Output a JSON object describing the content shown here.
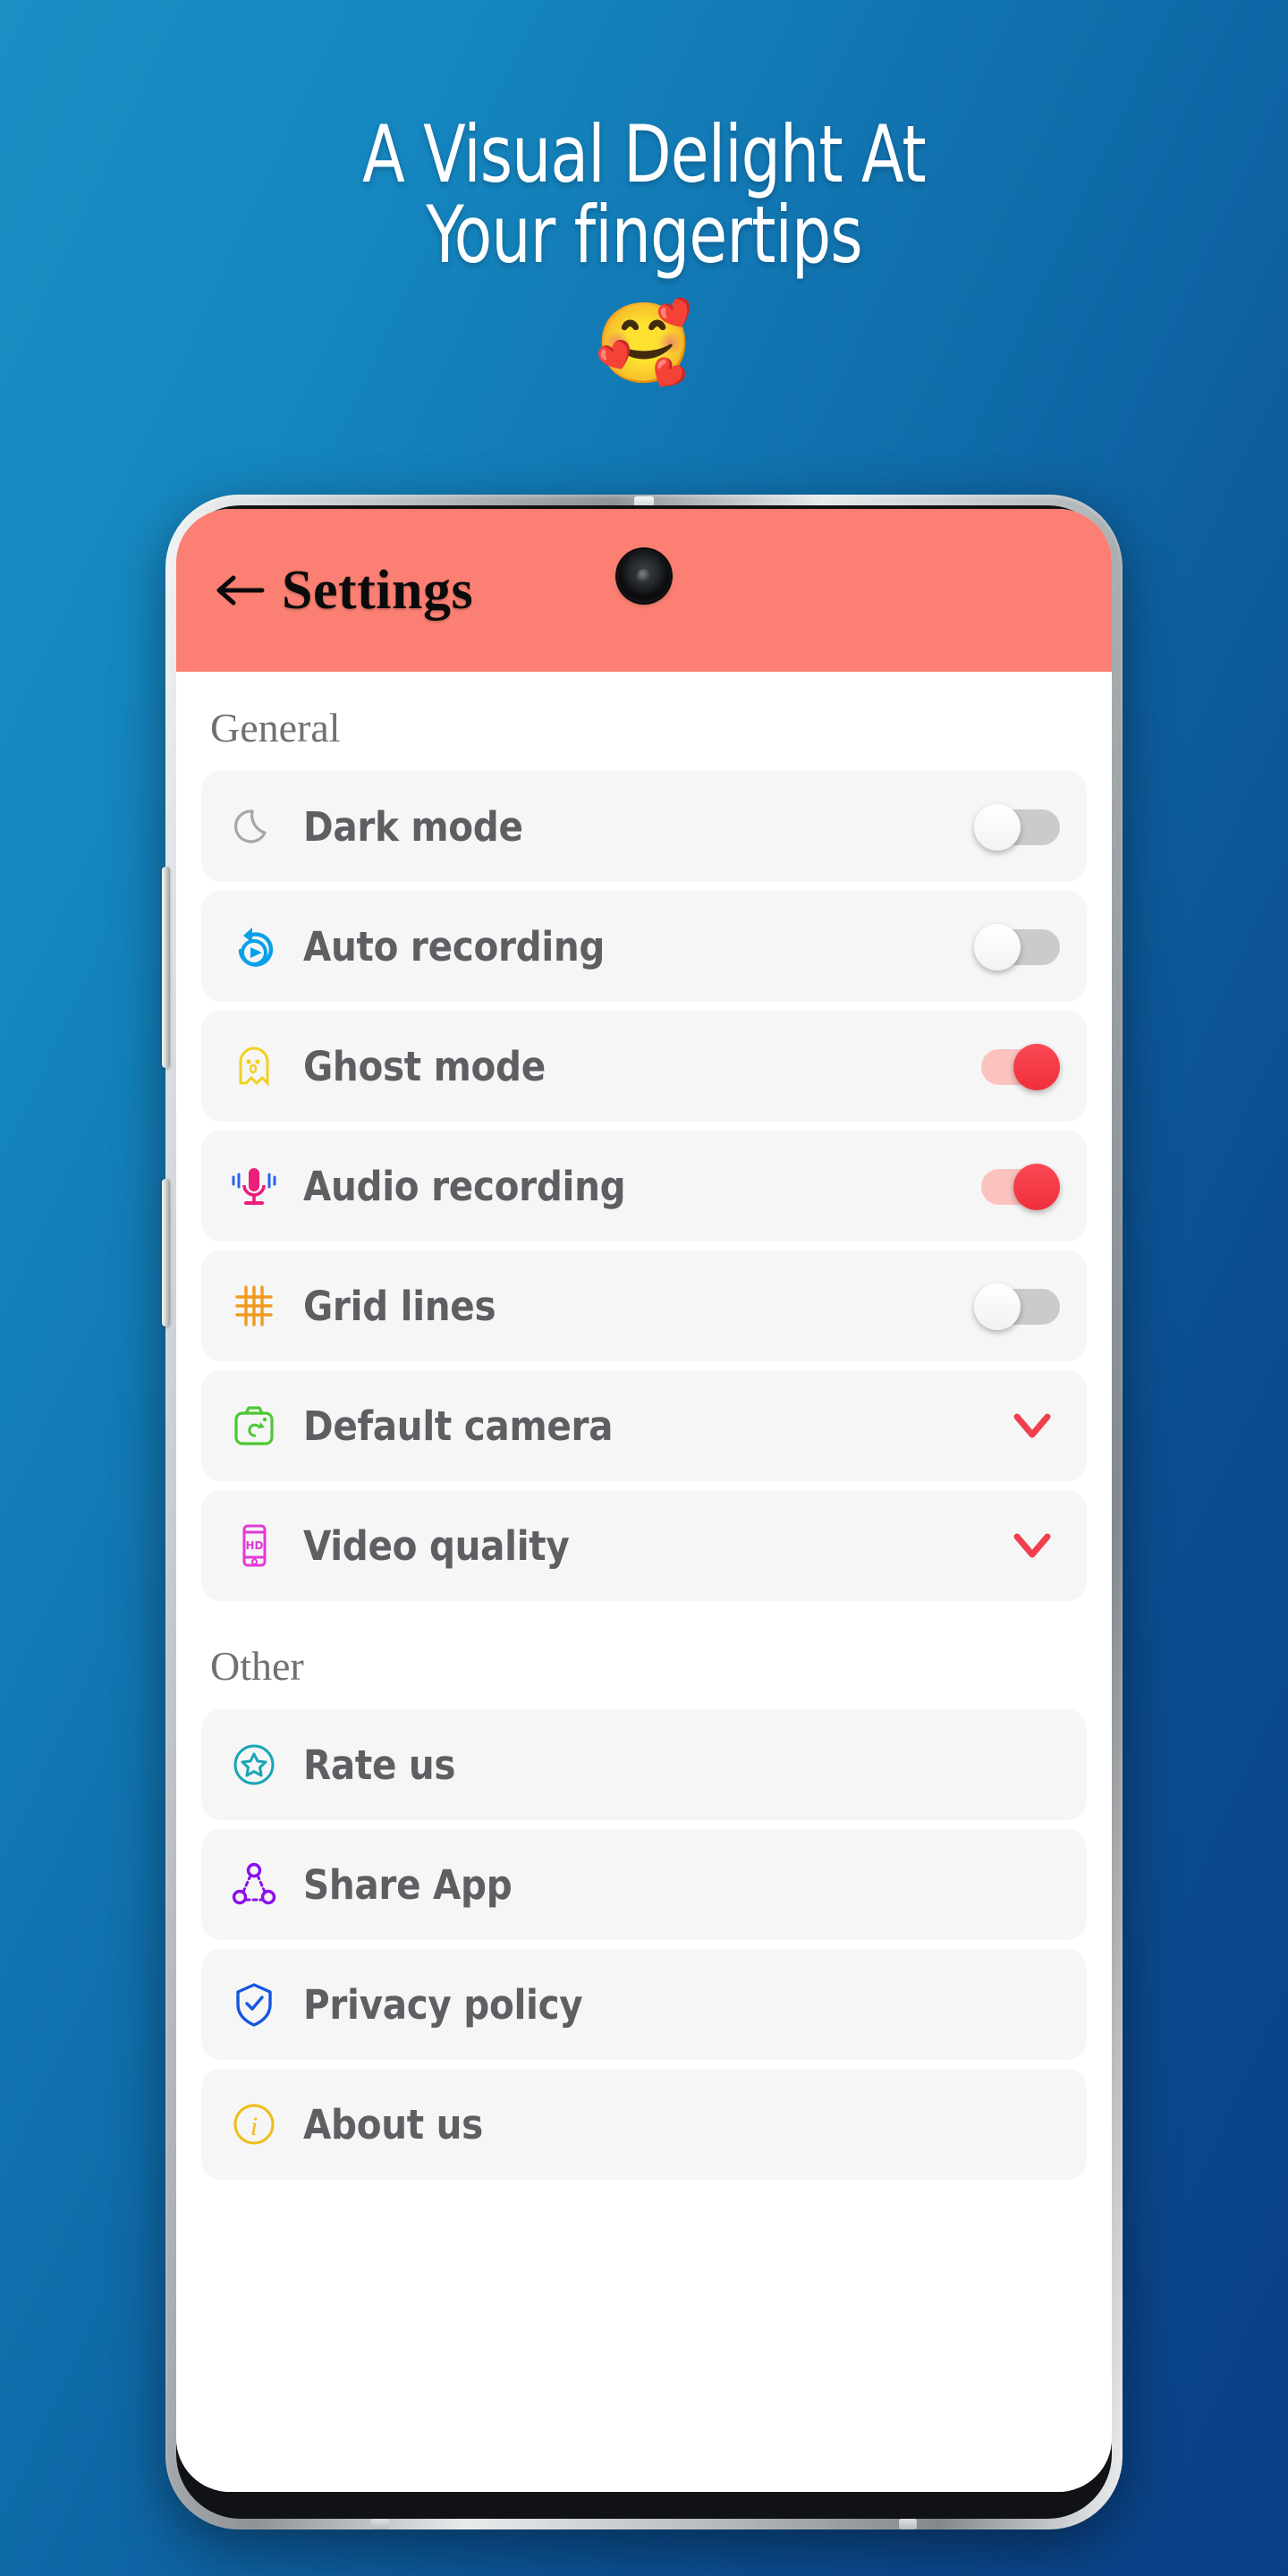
{
  "promo": {
    "line1": "A Visual Delight At",
    "line2": "Your fingertips",
    "emoji": "🥰",
    "emoji_name": "smiling-face-with-hearts"
  },
  "colors": {
    "background_top": "#1b8fc4",
    "background_bottom": "#0a3f85",
    "header": "#fb7f72",
    "toggle_on": "#f02e3c",
    "toggle_on_track": "#fbc3c0",
    "toggle_off_track": "#c9cbcd",
    "chevron": "#f0404d",
    "label_text": "#5d5f62",
    "section_text": "#6f7174",
    "row_background": "#f6f6f6"
  },
  "app": {
    "header": {
      "title": "Settings",
      "back_icon": "arrow-left-icon",
      "camera_icon": "front-camera-punch-hole"
    },
    "sections": [
      {
        "title": "General",
        "rows": [
          {
            "label": "Dark mode",
            "icon": "moon-icon",
            "icon_color": "#9a9c9f",
            "control": "toggle",
            "state": "off"
          },
          {
            "label": "Auto recording",
            "icon": "auto-record-icon",
            "icon_color": "#0aa0e8",
            "control": "toggle",
            "state": "off"
          },
          {
            "label": "Ghost mode",
            "icon": "ghost-icon",
            "icon_color": "#f2d021",
            "control": "toggle",
            "state": "on"
          },
          {
            "label": "Audio recording",
            "icon": "microphone-icon",
            "icon_color": "#ec1f7a",
            "control": "toggle",
            "state": "on"
          },
          {
            "label": "Grid lines",
            "icon": "grid-icon",
            "icon_color": "#f09a21",
            "control": "toggle",
            "state": "off"
          },
          {
            "label": "Default camera",
            "icon": "camera-switch-icon",
            "icon_color": "#4cc831",
            "control": "chevron"
          },
          {
            "label": "Video quality",
            "icon": "hd-phone-icon",
            "icon_color": "#e23ad6",
            "control": "chevron"
          }
        ]
      },
      {
        "title": "Other",
        "rows": [
          {
            "label": "Rate us",
            "icon": "star-circle-icon",
            "icon_color": "#18a5b5",
            "control": "none"
          },
          {
            "label": "Share App",
            "icon": "share-nodes-icon",
            "icon_color": "#8b0df0",
            "control": "none"
          },
          {
            "label": "Privacy policy",
            "icon": "shield-check-icon",
            "icon_color": "#1656e0",
            "control": "none"
          },
          {
            "label": "About us",
            "icon": "info-circle-icon",
            "icon_color": "#f0bc1a",
            "control": "none"
          }
        ]
      }
    ]
  }
}
